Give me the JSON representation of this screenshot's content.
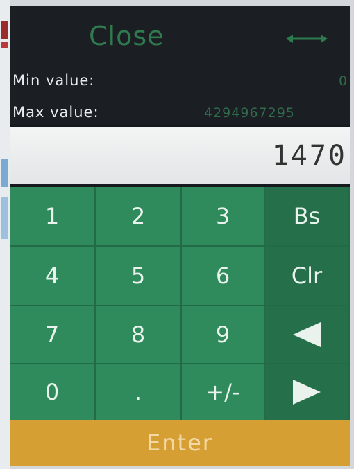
{
  "header": {
    "close_label": "Close",
    "min_label": "Min value:",
    "min_value": "0",
    "max_label": "Max value:",
    "max_value": "4294967295"
  },
  "display": {
    "value": "1470"
  },
  "keypad": {
    "k1": "1",
    "k2": "2",
    "k3": "3",
    "bs": "Bs",
    "k4": "4",
    "k5": "5",
    "k6": "6",
    "clr": "Clr",
    "k7": "7",
    "k8": "8",
    "k9": "9",
    "k0": "0",
    "dot": ".",
    "sign": "+/-"
  },
  "enter_label": "Enter",
  "icons": {
    "left": "arrow-left-icon",
    "right": "arrow-right-icon",
    "resize": "horizontal-arrows-icon"
  },
  "colors": {
    "key_green": "#2f8a5c",
    "key_dark": "#25704b",
    "enter": "#d69f33"
  }
}
